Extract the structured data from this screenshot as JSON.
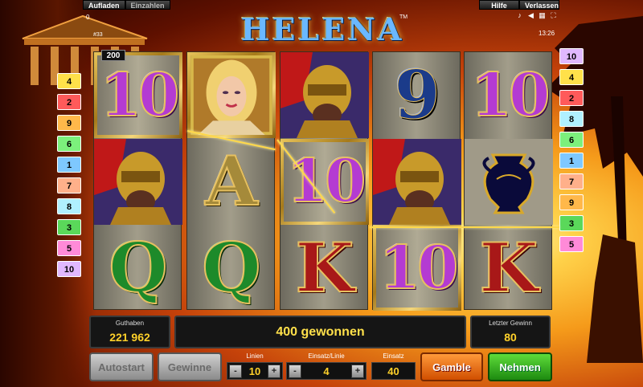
{
  "game": {
    "title": "HELENA",
    "trademark": "TM",
    "clock": "13:26"
  },
  "topbar": {
    "load_label": "Aufladen",
    "cashout_label": "Einzahlen",
    "help_label": "Hilfe",
    "exit_label": "Verlassen",
    "load_value": "0",
    "session_id": "#33"
  },
  "sys_icons": [
    "music-icon",
    "volume-icon",
    "grid-icon",
    "fullscreen-icon"
  ],
  "markers_left": [
    "4",
    "2",
    "9",
    "6",
    "1",
    "7",
    "8",
    "3",
    "5",
    "10"
  ],
  "markers_right": [
    "10",
    "4",
    "2",
    "8",
    "6",
    "1",
    "7",
    "9",
    "3",
    "5"
  ],
  "marker_colors": {
    "1": "#7ec8ff",
    "2": "#ff5a5a",
    "3": "#5ad85a",
    "4": "#ffe14a",
    "5": "#ff8ad8",
    "6": "#7cf07c",
    "7": "#ffb08a",
    "8": "#b0f0ff",
    "9": "#ffb84a",
    "10": "#e0b8ff"
  },
  "reels": [
    [
      "10",
      "warrior",
      "Q"
    ],
    [
      "helena",
      "A",
      "Q"
    ],
    [
      "warrior",
      "10",
      "K"
    ],
    [
      "9",
      "warrior",
      "10"
    ],
    [
      "10",
      "vase",
      "K"
    ]
  ],
  "win_badge": "200",
  "panel": {
    "balance_label": "Guthaben",
    "balance_value": "221 962",
    "message": "400 gewonnen",
    "last_win_label": "Letzter Gewinn",
    "last_win_value": "80"
  },
  "controls": {
    "autostart_label": "Autostart",
    "wins_label": "Gewinne",
    "lines_label": "Linien",
    "lines_value": "10",
    "bet_per_line_label": "Einsatz/Linie",
    "bet_per_line_value": "4",
    "bet_label": "Einsatz",
    "bet_value": "40",
    "gamble_label": "Gamble",
    "take_label": "Nehmen",
    "minus": "-",
    "plus": "+"
  }
}
